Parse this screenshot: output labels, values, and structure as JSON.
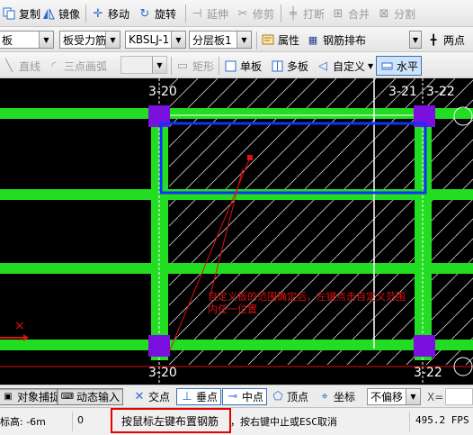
{
  "toolbar1": {
    "copy": "复制",
    "mirror": "镜像",
    "move": "移动",
    "rotate": "旋转",
    "extend": "延伸",
    "trim": "修剪",
    "break": "打断",
    "merge": "合并",
    "split": "分割"
  },
  "toolbar2": {
    "element_type": "板",
    "rebar_type": "板受力筋",
    "rebar_name": "KBSLJ-1",
    "layer": "分层板1",
    "properties": "属性",
    "rebar_layout": "钢筋排布",
    "two_points": "两点"
  },
  "toolbar3": {
    "line": "直线",
    "three_point_arc": "三点画弧",
    "rectangle": "矩形",
    "single_slab": "单板",
    "multi_slab": "多板",
    "custom": "自定义",
    "horizontal": "水平"
  },
  "canvas": {
    "grid_labels": [
      "3-20",
      "3-21",
      "3-22",
      "3-20",
      "3-22"
    ],
    "annotation_line1": "自定义板的范围确定后，左键点击自定义范围",
    "annotation_line2": "内任一位置"
  },
  "snapbar": {
    "object_snap": "对象捕捉",
    "dynamic_input": "动态输入",
    "intersection": "交点",
    "perpendicular": "垂点",
    "midpoint": "中点",
    "vertex": "顶点",
    "coordinate": "坐标",
    "offset_mode": "不偏移",
    "x_label": "X="
  },
  "statusbar": {
    "elevation": "标高: -6m",
    "value": "0",
    "prompt_main": "按鼠标左键布置钢筋",
    "prompt_rest": "，按右键中止或ESC取消",
    "fps": "495.2 FPS"
  },
  "colors": {
    "beam": "#22dd22",
    "column": "#7a10e0",
    "selection": "#1030ff",
    "annotation": "#e01010",
    "highlight_box": "#e60000"
  }
}
